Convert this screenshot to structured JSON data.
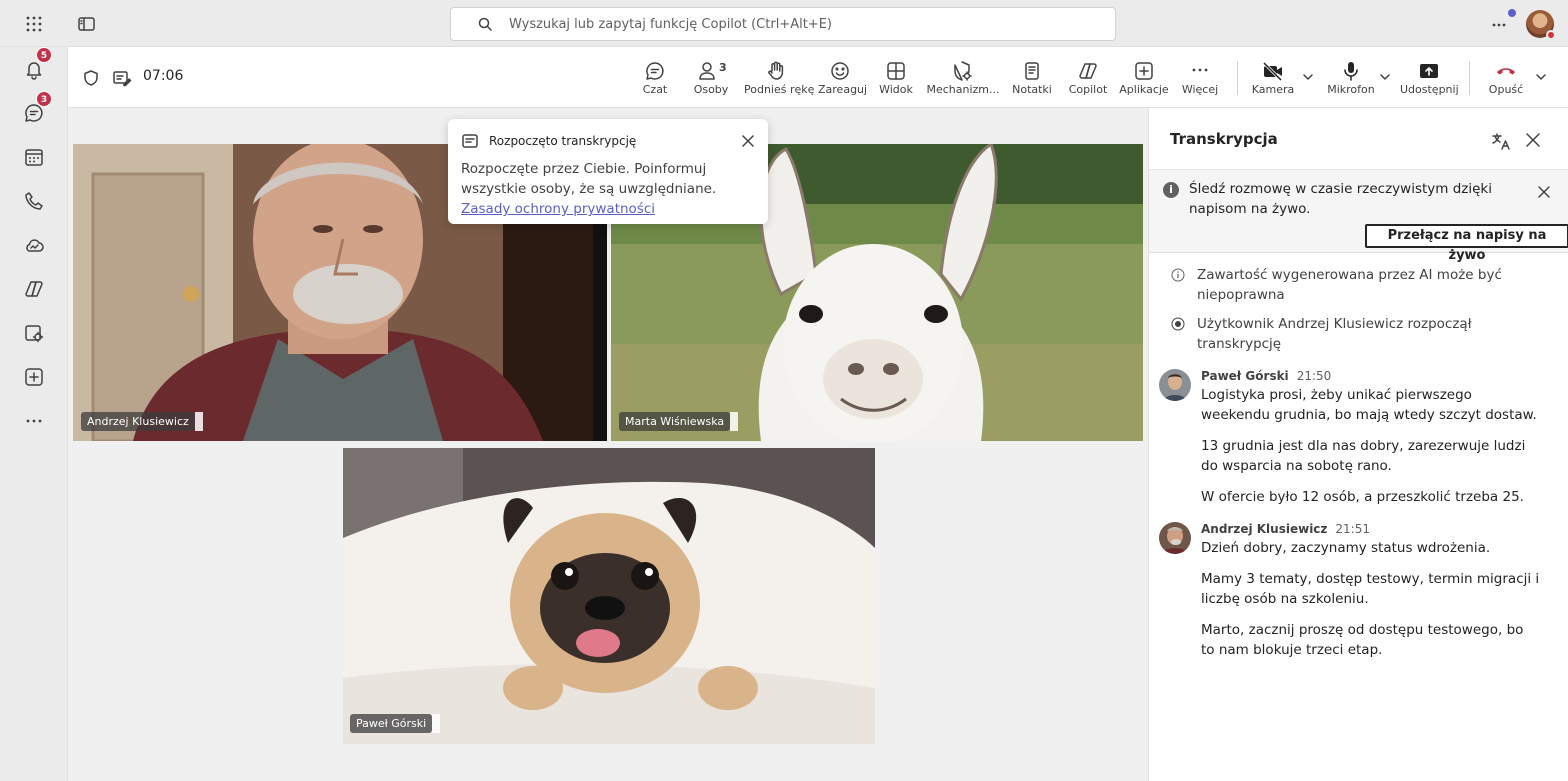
{
  "search": {
    "placeholder": "Wyszukaj lub zapytaj funkcję Copilot (Ctrl+Alt+E)"
  },
  "rail": {
    "activity_badge": "5",
    "chat_badge": "3"
  },
  "meeting": {
    "timer": "07:06",
    "toolbar": [
      {
        "id": "chat",
        "label": "Czat",
        "icon": "chat-icon"
      },
      {
        "id": "people",
        "label": "Osoby",
        "icon": "people-icon",
        "count": "3"
      },
      {
        "id": "raise",
        "label": "Podnieś rękę",
        "icon": "hand-icon"
      },
      {
        "id": "react",
        "label": "Zareaguj",
        "icon": "smile-icon"
      },
      {
        "id": "view",
        "label": "Widok",
        "icon": "grid-icon"
      },
      {
        "id": "mech",
        "label": "Mechanizm...",
        "icon": "shield-gear-icon"
      },
      {
        "id": "notes",
        "label": "Notatki",
        "icon": "notes-icon"
      },
      {
        "id": "copilot",
        "label": "Copilot",
        "icon": "copilot-icon"
      },
      {
        "id": "apps",
        "label": "Aplikacje",
        "icon": "add-app-icon"
      },
      {
        "id": "more",
        "label": "Więcej",
        "icon": "more-icon"
      },
      {
        "id": "camera",
        "label": "Kamera",
        "icon": "camera-off-icon"
      },
      {
        "id": "mic",
        "label": "Mikrofon",
        "icon": "mic-icon"
      },
      {
        "id": "share",
        "label": "Udostępnij",
        "icon": "share-icon"
      },
      {
        "id": "leave",
        "label": "Opuść",
        "icon": "hangup-icon",
        "color": "#c4314b"
      }
    ]
  },
  "participants": [
    {
      "name": "Andrzej Klusiewicz"
    },
    {
      "name": "Marta Wiśniewska"
    },
    {
      "name": "Paweł Górski"
    }
  ],
  "popup": {
    "title": "Rozpoczęto transkrypcję",
    "body": "Rozpoczęte przez Ciebie. Poinformuj wszystkie osoby, że są uwzględniane.",
    "link": "Zasady ochrony prywatności"
  },
  "panel": {
    "title": "Transkrypcja",
    "banner_text": "Śledź rozmowę w czasie rzeczywistym dzięki napisom na żywo.",
    "switch_button": "Przełącz na napisy na żywo",
    "ai_notice": "Zawartość wygenerowana przez AI może być niepoprawna",
    "started_notice": "Użytkownik Andrzej Klusiewicz rozpoczął transkrypcję",
    "entries": [
      {
        "speaker": "Paweł Górski",
        "time": "21:50",
        "messages": [
          "Logistyka prosi, żeby unikać pierwszego weekendu grudnia, bo mają wtedy szczyt dostaw.",
          "13 grudnia jest dla nas dobry, zarezerwuje ludzi do wsparcia na sobotę rano.",
          "W ofercie było 12 osób, a przeszkolić trzeba 25."
        ]
      },
      {
        "speaker": "Andrzej Klusiewicz",
        "time": "21:51",
        "messages": [
          "Dzień dobry, zaczynamy status wdrożenia.",
          "Mamy 3 tematy, dostęp testowy, termin migracji i liczbę osób na szkoleniu.",
          "Marto, zacznij proszę od dostępu testowego, bo to nam blokuje trzeci etap."
        ]
      }
    ]
  }
}
